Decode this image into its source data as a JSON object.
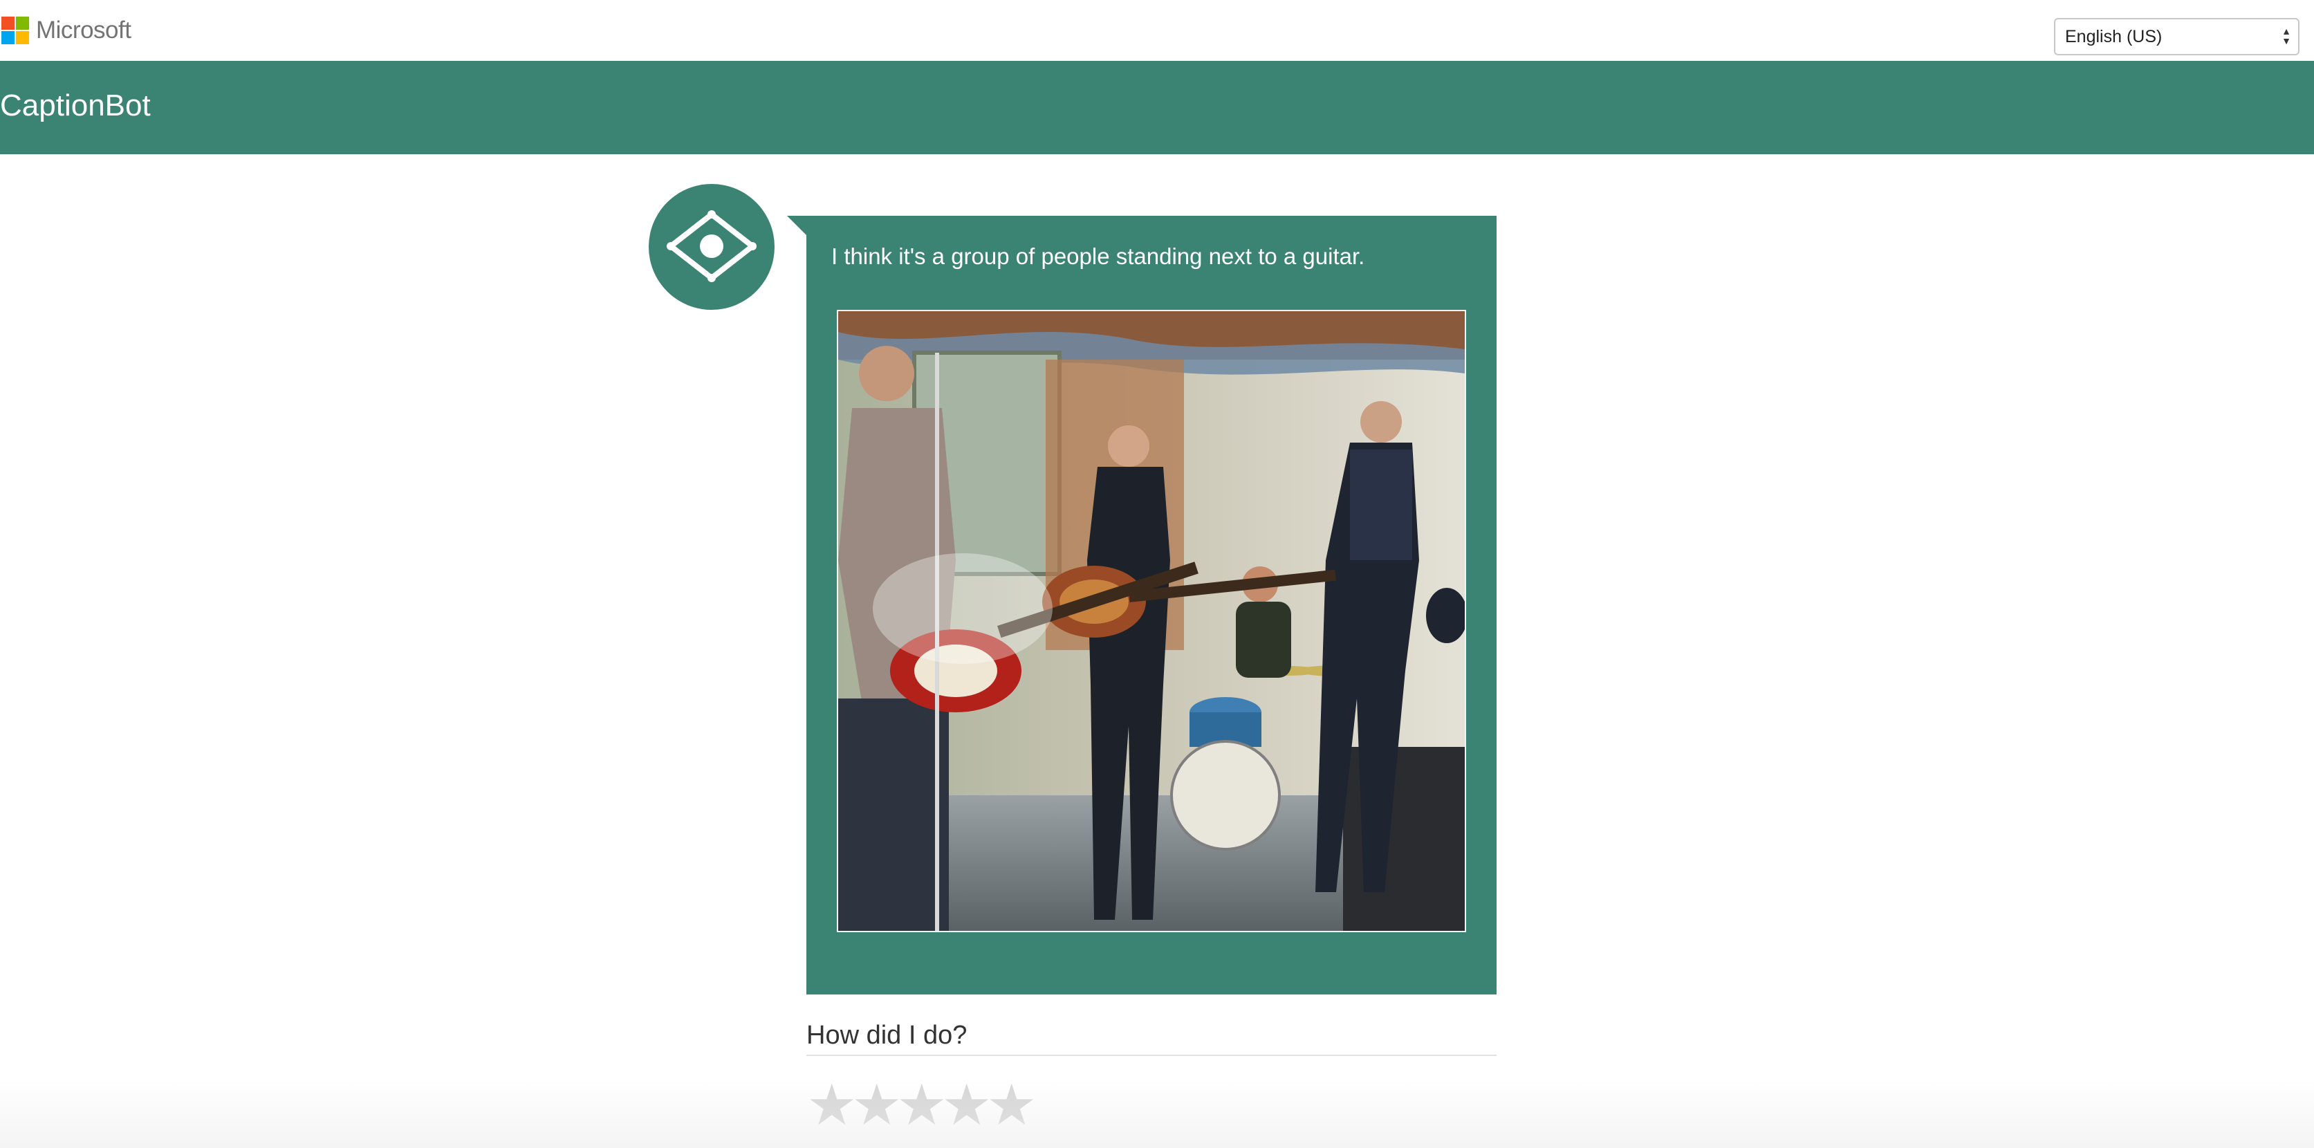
{
  "topbar": {
    "brand": "Microsoft",
    "logo_colors": [
      "#f25022",
      "#7fba00",
      "#00a4ef",
      "#ffb900"
    ],
    "language_select": {
      "selected": "English (US)"
    }
  },
  "header": {
    "title": "CaptionBot",
    "background_color": "#3b8474"
  },
  "chat": {
    "avatar_icon": "eye-icon",
    "caption": "I think it's a group of people standing next to a guitar.",
    "image_icon": "band-photo"
  },
  "feedback": {
    "question": "How did I do?",
    "stars": [
      "★",
      "★",
      "★",
      "★",
      "★"
    ],
    "rating_max": 5,
    "rating_value": 0
  }
}
